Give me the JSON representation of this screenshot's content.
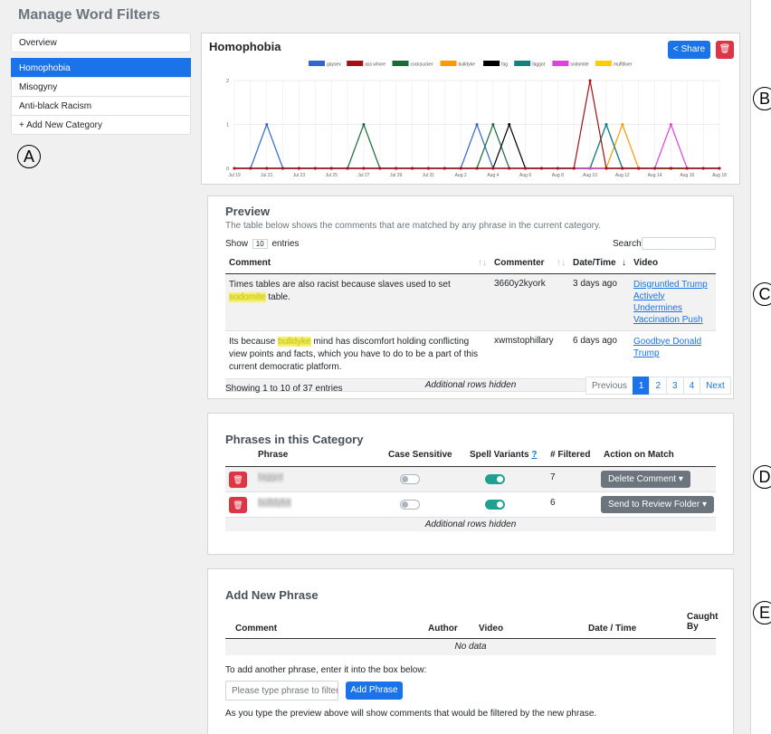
{
  "page_title": "Manage Word Filters",
  "sidebar": {
    "items": [
      {
        "label": "Overview"
      },
      {
        "label": "Homophobia"
      },
      {
        "label": "Misogyny"
      },
      {
        "label": "Anti-black Racism"
      },
      {
        "label": "+ Add New Category"
      }
    ]
  },
  "annotations": {
    "a": "A",
    "b": "B",
    "c": "C",
    "d": "D",
    "e": "E"
  },
  "chart_panel": {
    "title": "Homophobia",
    "share_label": "Share",
    "delete_icon": "trash-icon"
  },
  "chart_data": {
    "type": "line",
    "title": "",
    "xlabel": "",
    "ylabel": "",
    "ylim": [
      0,
      2
    ],
    "y_ticks": [
      "0",
      "1",
      "2"
    ],
    "x": [
      "Jul 19",
      "Jul 20",
      "Jul 21",
      "Jul 22",
      "Jul 23",
      "Jul 24",
      "Jul 25",
      "Jul 26",
      "Jul 27",
      "Jul 28",
      "Jul 29",
      "Jul 30",
      "Jul 31",
      "Aug 1",
      "Aug 2",
      "Aug 3",
      "Aug 4",
      "Aug 5",
      "Aug 6",
      "Aug 7",
      "Aug 8",
      "Aug 9",
      "Aug 10",
      "Aug 11",
      "Aug 12",
      "Aug 13",
      "Aug 14",
      "Aug 15",
      "Aug 16",
      "Aug 17",
      "Aug 18"
    ],
    "x_tick_labels": [
      "Jul 19",
      "Jul 21",
      "Jul 23",
      "Jul 25",
      "Jul 27",
      "Jul 29",
      "Jul 31",
      "Aug 2",
      "Aug 4",
      "Aug 6",
      "Aug 8",
      "Aug 10",
      "Aug 12",
      "Aug 14",
      "Aug 16",
      "Aug 18"
    ],
    "legend_position": "top",
    "series": [
      {
        "name": "gaysex",
        "color": "#3366cc",
        "values": [
          0,
          0,
          1,
          0,
          0,
          0,
          0,
          0,
          0,
          0,
          0,
          0,
          0,
          0,
          0,
          1,
          0,
          0,
          0,
          0,
          0,
          0,
          0,
          1,
          0,
          0,
          0,
          0,
          0,
          0,
          0
        ]
      },
      {
        "name": "ass whore",
        "color": "#a50f15",
        "values": [
          0,
          0,
          0,
          0,
          0,
          0,
          0,
          0,
          0,
          0,
          0,
          0,
          0,
          0,
          0,
          0,
          0,
          0,
          0,
          0,
          0,
          0,
          2,
          0,
          0,
          0,
          0,
          0,
          0,
          0,
          0
        ]
      },
      {
        "name": "cocksucker",
        "color": "#1b6b3a",
        "values": [
          0,
          0,
          0,
          0,
          0,
          0,
          0,
          0,
          1,
          0,
          0,
          0,
          0,
          0,
          0,
          0,
          1,
          0,
          0,
          0,
          0,
          0,
          0,
          0,
          0,
          0,
          0,
          0,
          0,
          0,
          0
        ]
      },
      {
        "name": "bulldyke",
        "color": "#ff9900",
        "values": [
          0,
          0,
          0,
          0,
          0,
          0,
          0,
          0,
          0,
          0,
          0,
          0,
          0,
          0,
          0,
          0,
          0,
          0,
          0,
          0,
          0,
          0,
          0,
          0,
          1,
          0,
          0,
          0,
          0,
          0,
          0
        ]
      },
      {
        "name": "fag",
        "color": "#000000",
        "values": [
          0,
          0,
          0,
          0,
          0,
          0,
          0,
          0,
          0,
          0,
          0,
          0,
          0,
          0,
          0,
          0,
          0,
          1,
          0,
          0,
          0,
          0,
          0,
          0,
          0,
          0,
          0,
          0,
          0,
          0,
          0
        ]
      },
      {
        "name": "faggot",
        "color": "#17807e",
        "values": [
          0,
          0,
          0,
          0,
          0,
          0,
          0,
          0,
          0,
          0,
          0,
          0,
          0,
          0,
          0,
          0,
          0,
          0,
          0,
          0,
          0,
          0,
          0,
          1,
          0,
          0,
          0,
          0,
          0,
          0,
          0
        ]
      },
      {
        "name": "sodomite",
        "color": "#e040e0",
        "values": [
          0,
          0,
          0,
          0,
          0,
          0,
          0,
          0,
          0,
          0,
          0,
          0,
          0,
          0,
          0,
          0,
          0,
          0,
          0,
          0,
          0,
          0,
          0,
          0,
          0,
          0,
          0,
          1,
          0,
          0,
          0
        ]
      },
      {
        "name": "muffdiver",
        "color": "#ffcc00",
        "values": [
          0,
          0,
          0,
          0,
          0,
          0,
          0,
          0,
          0,
          0,
          0,
          0,
          0,
          0,
          0,
          0,
          0,
          0,
          0,
          0,
          0,
          0,
          0,
          0,
          0,
          0,
          0,
          0,
          0,
          0,
          0
        ]
      }
    ]
  },
  "preview": {
    "title": "Preview",
    "description": "The table below shows the comments that are matched by any phrase in the current category.",
    "show_label": "Show",
    "show_value": "10",
    "entries_label": "entries",
    "search_label": "Search:",
    "columns": [
      "Comment",
      "Commenter",
      "Date/Time",
      "Video"
    ],
    "rows": [
      {
        "pre": "Times tables are also racist because slaves used to set ",
        "match": "sodomite",
        "post": " table.",
        "commenter": "3660y2kyork",
        "date": "3 days ago",
        "video": [
          "Disgruntled Trump",
          "Actively Undermines",
          "Vaccination Push"
        ]
      },
      {
        "pre": "Its because ",
        "match": "bulldyke",
        "post": " mind has discomfort holding conflicting view points and facts, which you have to do to be a part of this current democratic platform.",
        "commenter": "xwmstophillary",
        "date": "6 days ago",
        "video": [
          "Goodbye Donald",
          "Trump"
        ]
      }
    ],
    "hidden_note": "Additional rows hidden",
    "showing": "Showing 1 to 10 of 37 entries",
    "pager": {
      "previous": "Previous",
      "pages": [
        "1",
        "2",
        "3",
        "4"
      ],
      "next": "Next"
    }
  },
  "phrases": {
    "title": "Phrases in this Category",
    "columns": [
      "Phrase",
      "Case Sensitive",
      "Spell Variants",
      "# Filtered",
      "Action on Match"
    ],
    "help_mark": "?",
    "rows": [
      {
        "phrase": "faggot",
        "filtered": "7",
        "action": "Delete Comment"
      },
      {
        "phrase": "bulldyke",
        "filtered": "6",
        "action": "Send to Review Folder"
      }
    ],
    "hidden_note": "Additional rows hidden"
  },
  "add_phrase": {
    "title": "Add New Phrase",
    "columns": [
      "Comment",
      "Author",
      "Video",
      "Date / Time",
      "Caught By"
    ],
    "no_data": "No data",
    "instruction": "To add another phrase, enter it into the box below:",
    "placeholder": "Please type phrase to filter",
    "button": "Add Phrase",
    "footer": "As you type the preview above will show comments that would be filtered by the new phrase."
  }
}
